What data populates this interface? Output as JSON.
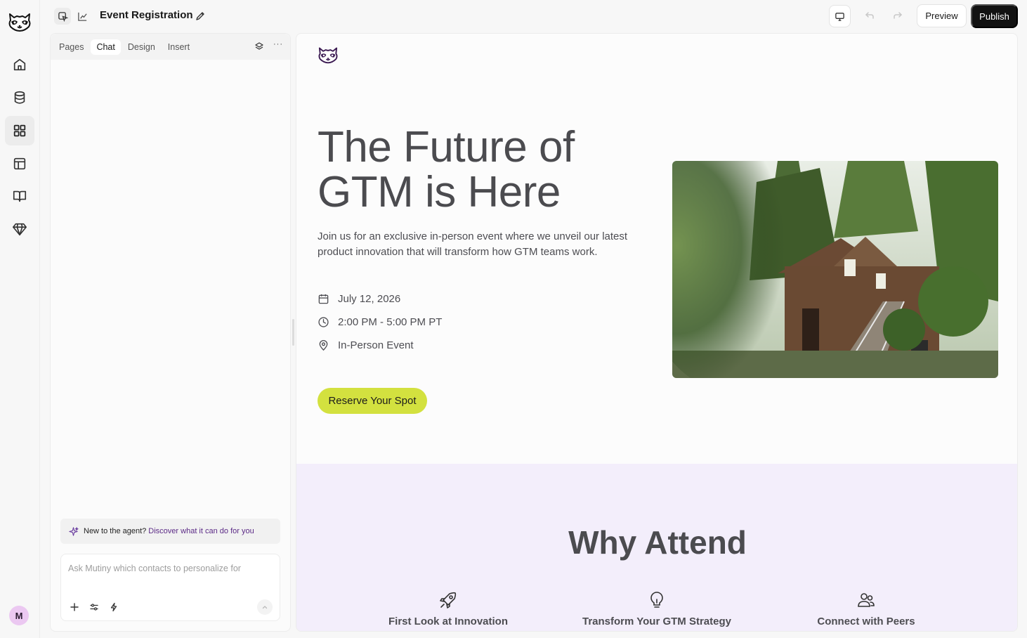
{
  "app": {
    "page_title": "Event Registration"
  },
  "rail": {
    "items": [
      {
        "icon": "home-icon"
      },
      {
        "icon": "database-icon"
      },
      {
        "icon": "grid-icon",
        "active": true
      },
      {
        "icon": "layout-icon"
      },
      {
        "icon": "book-icon"
      },
      {
        "icon": "diamond-icon"
      }
    ],
    "avatar_initial": "M"
  },
  "toolbar": {
    "preview_label": "Preview",
    "publish_label": "Publish"
  },
  "panel": {
    "tabs": [
      {
        "label": "Pages"
      },
      {
        "label": "Chat",
        "active": true
      },
      {
        "label": "Design"
      },
      {
        "label": "Insert"
      }
    ],
    "more_label": "···",
    "hint_text": "New to the agent?",
    "hint_link": "Discover what it can do for you",
    "composer_placeholder": "Ask Mutiny which contacts to personalize for"
  },
  "hero": {
    "title": "The Future of GTM is Here",
    "subtitle": "Join us for an exclusive in-person event where we unveil our latest product innovation that will transform how GTM teams work.",
    "date": "July 12, 2026",
    "time": "2:00 PM - 5:00 PM PT",
    "location": "In-Person Event",
    "cta_label": "Reserve Your Spot"
  },
  "why": {
    "title": "Why Attend",
    "features": [
      {
        "icon": "rocket-icon",
        "label": "First Look at Innovation"
      },
      {
        "icon": "lightbulb-icon",
        "label": "Transform Your GTM Strategy"
      },
      {
        "icon": "users-icon",
        "label": "Connect with Peers"
      }
    ]
  },
  "colors": {
    "accent_lime": "#d3e13f",
    "publish_bg": "#121212",
    "why_bg": "#f3eefb",
    "avatar_bg": "#ebc8f1",
    "link_purple": "#5b2a86"
  }
}
